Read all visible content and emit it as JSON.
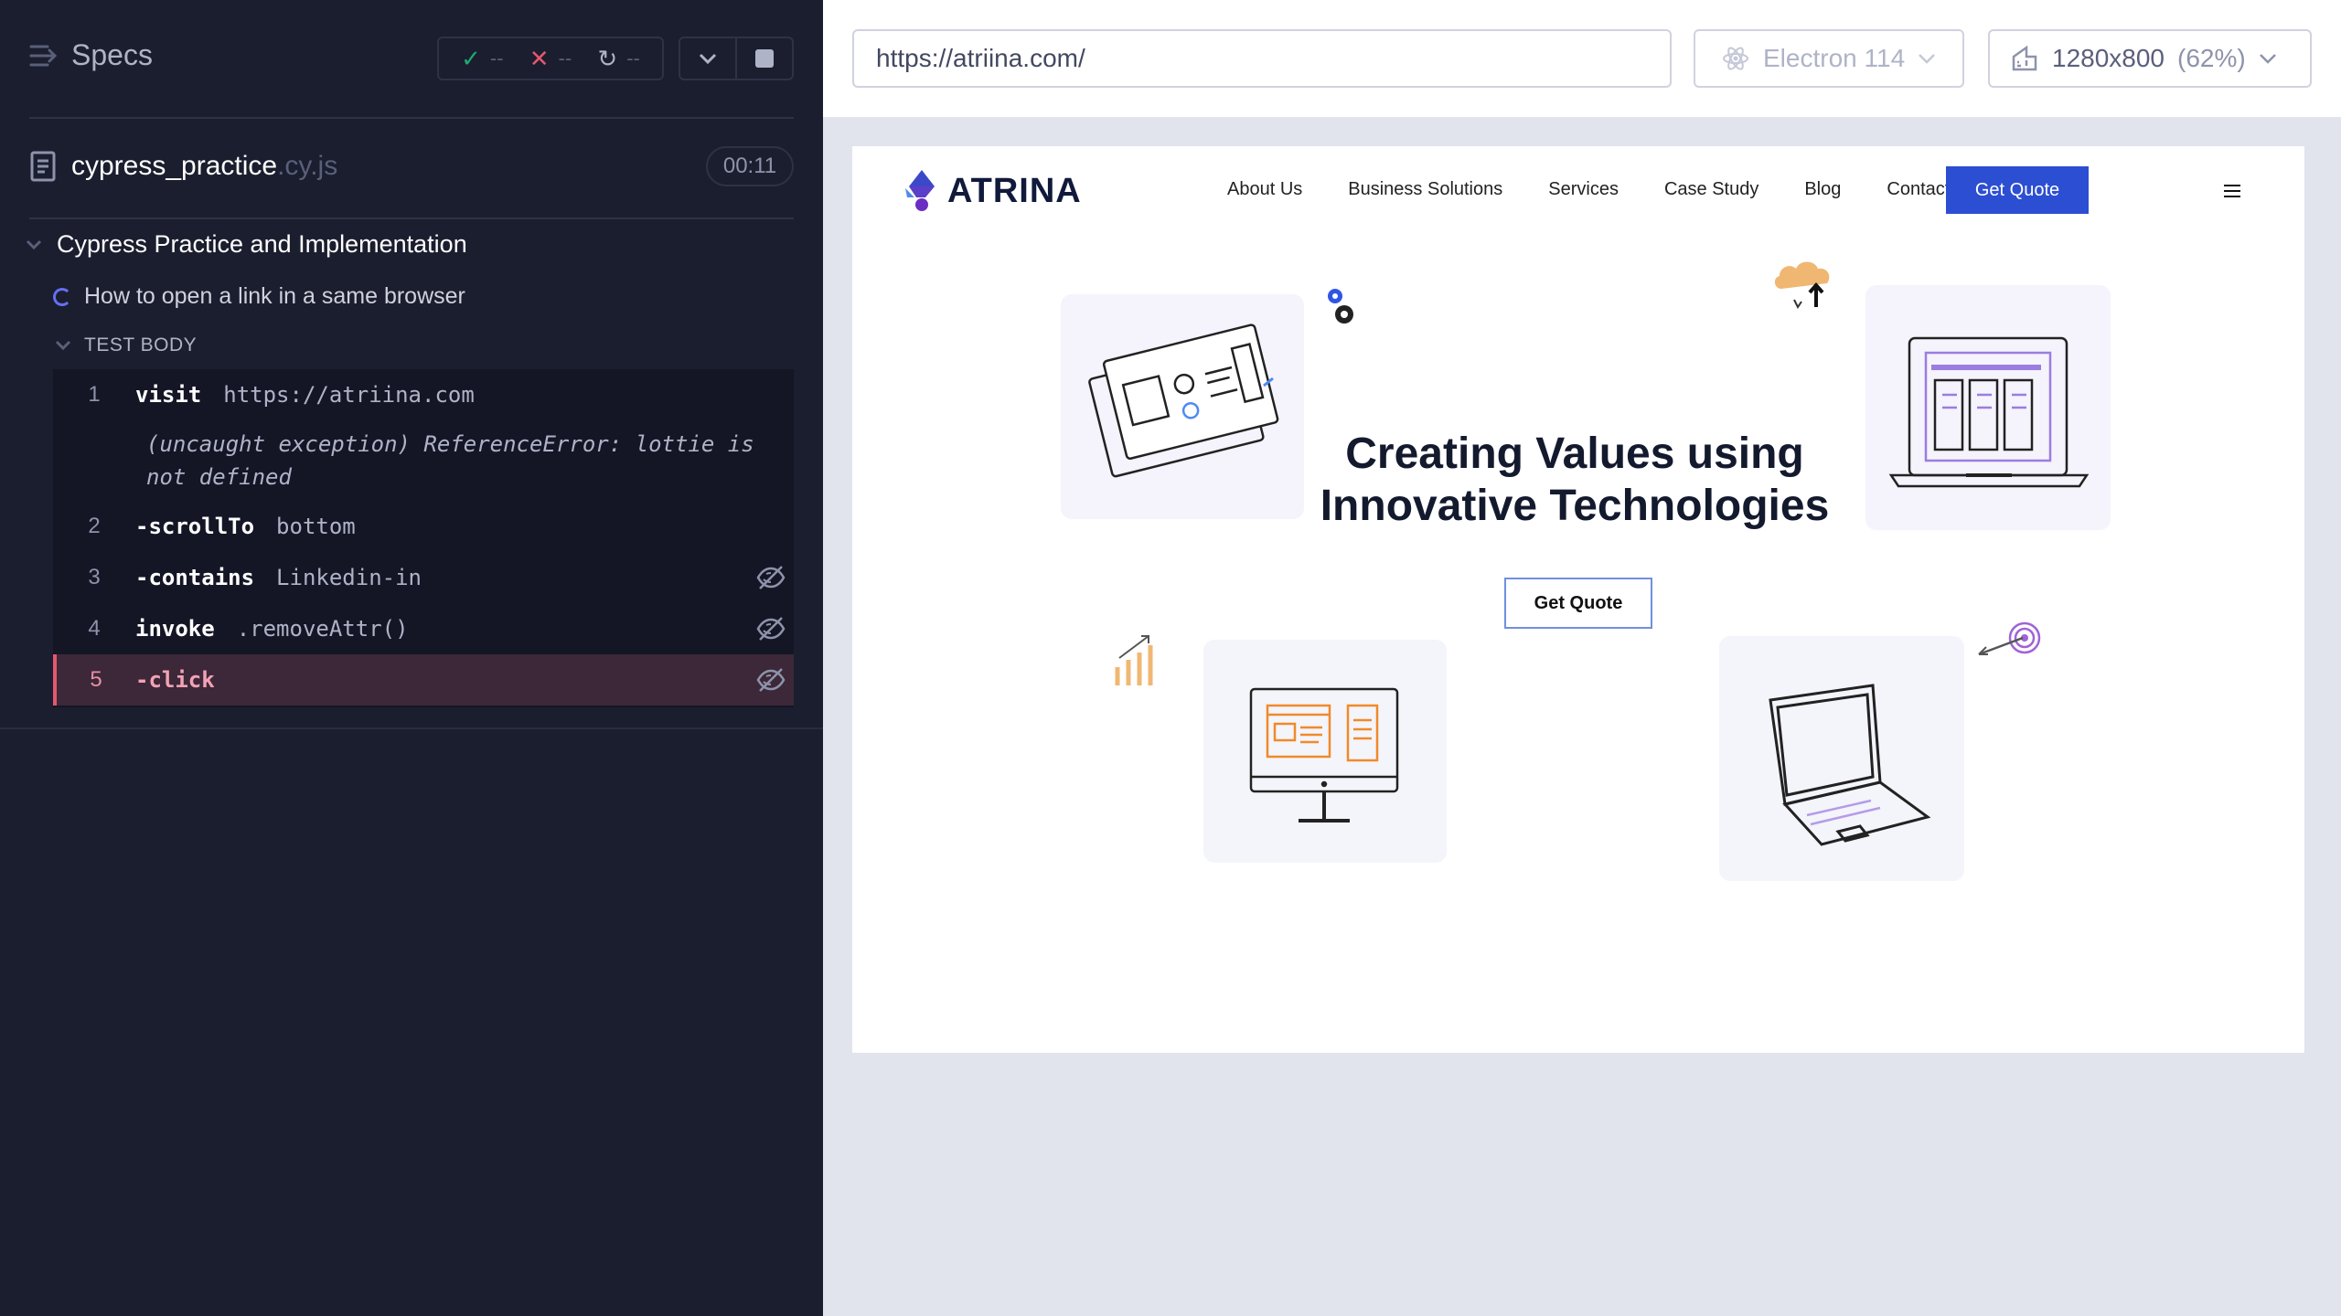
{
  "reporter": {
    "specs_label": "Specs",
    "stats": {
      "passed": "--",
      "failed": "--",
      "pending": "--"
    },
    "spec_file": {
      "name": "cypress_practice",
      "ext": ".cy.js",
      "duration": "00:11"
    },
    "suite_title": "Cypress Practice and Implementation",
    "test_title": "How to open a link in a same browser",
    "test_body_label": "TEST BODY",
    "commands": [
      {
        "num": "1",
        "name": "visit",
        "message": "https://atriina.com"
      },
      {
        "num": "2",
        "name": "-scrollTo",
        "message": "bottom"
      },
      {
        "num": "3",
        "name": "-contains",
        "message": "Linkedin-in"
      },
      {
        "num": "4",
        "name": "invoke",
        "message": ".removeAttr()"
      },
      {
        "num": "5",
        "name": "-click",
        "message": ""
      }
    ],
    "error": {
      "line1": "(uncaught exception)  ReferenceError: lottie is",
      "line2": "not defined"
    }
  },
  "aut": {
    "url": "https://atriina.com/",
    "browser": "Electron 114",
    "viewport": "1280x800",
    "scale": "(62%)"
  },
  "site": {
    "logo_text": "ATRINA",
    "nav": [
      "About Us",
      "Business Solutions",
      "Services",
      "Case Study",
      "Blog",
      "Contact Us"
    ],
    "cta_top": "Get Quote",
    "hero_line1": "Creating Values using",
    "hero_line2": "Innovative Technologies",
    "cta_hero": "Get Quote"
  },
  "colors": {
    "reporter_bg": "#1b1e2e",
    "pass": "#1fa971",
    "fail": "#e45770",
    "brand": "#2c4ed2",
    "active_cmd": "#3c2838"
  }
}
